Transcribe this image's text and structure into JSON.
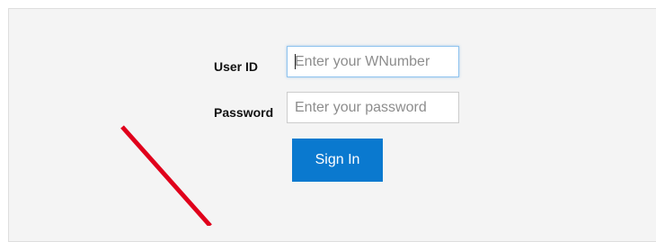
{
  "login_form": {
    "user_id_label": "User ID",
    "user_id_placeholder": "Enter your WNumber",
    "password_label": "Password",
    "password_placeholder": "Enter your password",
    "sign_in_label": "Sign In"
  },
  "colors": {
    "panel_background": "#f4f4f4",
    "button_background": "#0a79cf",
    "button_text": "#ffffff",
    "focus_border": "#8fc3ee",
    "annotation_arrow": "#e0001b"
  }
}
